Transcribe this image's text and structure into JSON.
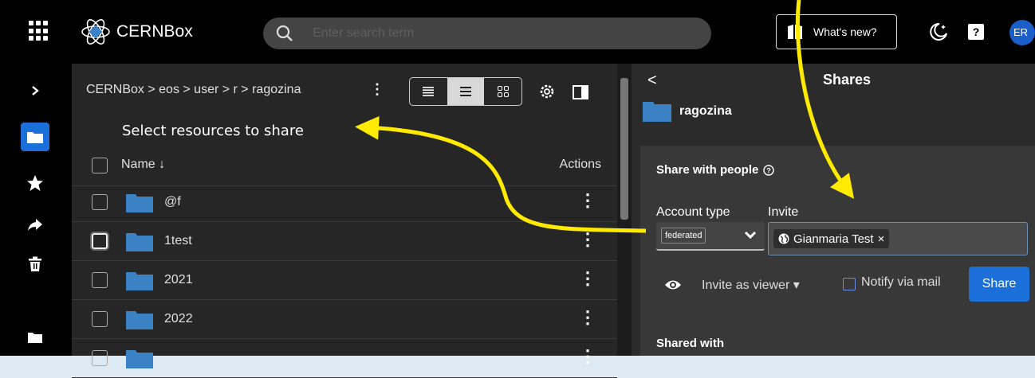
{
  "app": {
    "name": "CERNBox",
    "avatar_initials": "ER"
  },
  "search": {
    "placeholder": "Enter search term"
  },
  "topbar": {
    "whats_new": "What's new?",
    "help_glyph": "?"
  },
  "icons": {
    "apps": "app-grid-icon",
    "logo": "atom-icon",
    "search": "search-icon",
    "whats_new": "book-icon",
    "theme": "moon-icon",
    "help": "help-icon",
    "expand": "chevron-right-icon",
    "personal": "folder-icon",
    "favorites": "star-icon",
    "shared": "share-arrow-icon",
    "trash": "trash-icon",
    "projects": "folder-icon"
  },
  "breadcrumb": {
    "text": "CERNBox  >  eos  >  user  >  r  >  ragozina"
  },
  "annotation": {
    "hint": "Select resources to share"
  },
  "table": {
    "col_name": "Name ↓",
    "col_actions": "Actions",
    "rows": [
      {
        "name": "@f"
      },
      {
        "name": "1test"
      },
      {
        "name": "2021"
      },
      {
        "name": "2022"
      },
      {
        "name": ""
      }
    ]
  },
  "share_panel": {
    "back_glyph": "<",
    "title": "Shares",
    "resource_name": "ragozina",
    "share_with_people": "Share with people",
    "account_type_label": "Account type",
    "account_type_value": "federated",
    "invite_label": "Invite",
    "invitee": "Gianmaria Test",
    "invitee_remove": "×",
    "role": "Invite as viewer",
    "notify_label": "Notify via mail",
    "share_button": "Share",
    "shared_with": "Shared with"
  },
  "colors": {
    "accent": "#1a6fd8",
    "folder": "#3b82c4",
    "arrow": "#ffea00",
    "avatar": "#1a5fc9"
  }
}
